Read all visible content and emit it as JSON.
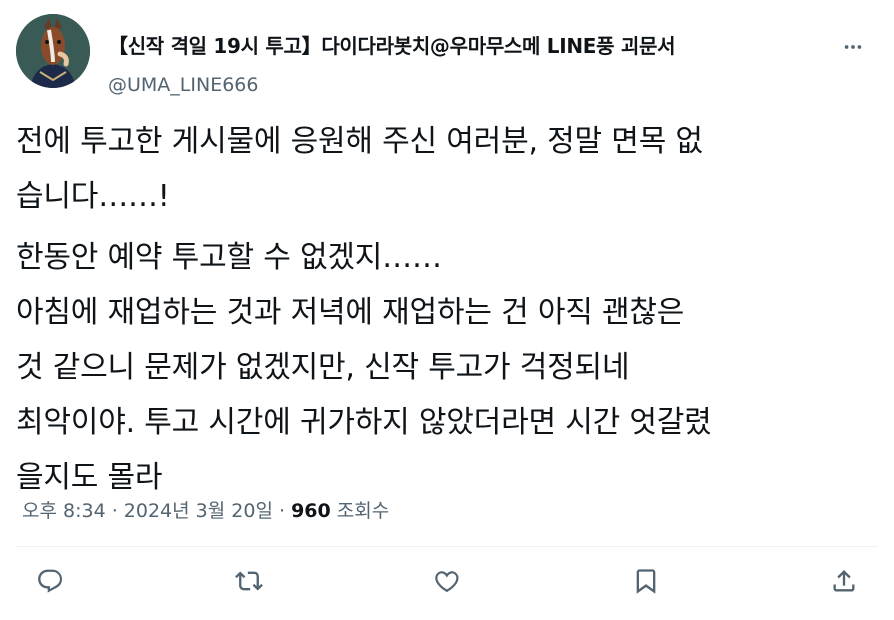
{
  "author": {
    "display_name": "【신작 격일 19시 투고】다이다라봇치@우마무스메 LINE풍 괴문서",
    "handle": "@UMA_LINE666"
  },
  "tweet": {
    "paragraphs": [
      "전에 투고한 게시물에 응원해 주신 여러분, 정말 면목 없\n습니다……!",
      "한동안 예약 투고할 수 없겠지……\n아침에 재업하는 것과 저녁에 재업하는 건 아직 괜찮은\n것 같으니 문제가 없겠지만, 신작 투고가 걱정되네\n최악이야. 투고 시간에 귀가하지 않았더라면 시간 엇갈렸\n을지도 몰라"
    ]
  },
  "meta": {
    "time": "오후 8:34",
    "separator": " · ",
    "date": "2024년 3월 20일",
    "views_count": "960",
    "views_label": " 조회수"
  },
  "icons": {
    "more": "more-horizontal-icon",
    "reply": "reply-bubble-icon",
    "retweet": "retweet-icon",
    "like": "heart-icon",
    "bookmark": "bookmark-icon",
    "share": "share-upload-icon"
  },
  "colors": {
    "text_primary": "#0f1419",
    "text_secondary": "#536471",
    "divider": "#eff3f4"
  }
}
